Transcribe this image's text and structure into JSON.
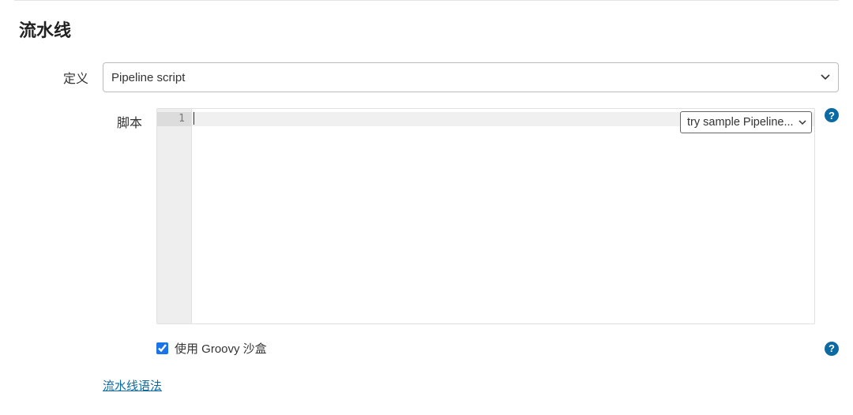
{
  "section": {
    "title": "流水线"
  },
  "definition": {
    "label": "定义",
    "selected": "Pipeline script"
  },
  "script": {
    "label": "脚本",
    "line_number": "1",
    "sample_selected": "try sample Pipeline..."
  },
  "sandbox": {
    "label": "使用 Groovy 沙盒",
    "checked": true
  },
  "syntax_link": {
    "label": "流水线语法"
  },
  "help_glyph": "?"
}
